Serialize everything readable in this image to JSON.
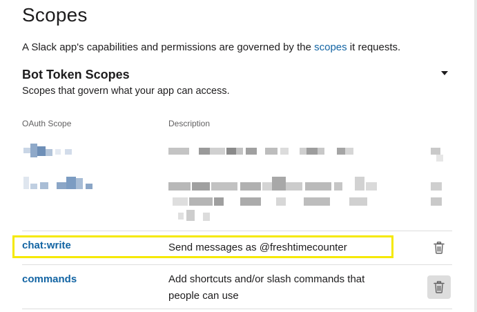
{
  "page": {
    "title": "Scopes",
    "intro_before": "A Slack app's capabilities and permissions are governed by the ",
    "intro_link": "scopes",
    "intro_after": " it requests."
  },
  "bot_section": {
    "title": "Bot Token Scopes",
    "subtitle": "Scopes that govern what your app can access.",
    "col_scope": "OAuth Scope",
    "col_description": "Description"
  },
  "scopes": [
    {
      "name": "chat:write",
      "description": "Send messages as @freshtimecounter",
      "highlighted": true
    },
    {
      "name": "commands",
      "description_line1": "Add shortcuts and/or slash commands that",
      "description_line2": "people can use"
    }
  ],
  "colors": {
    "link": "#1264a3",
    "highlight": "#f5e900",
    "text": "#1d1c1d",
    "muted": "#616061"
  },
  "icons": {
    "collapse": "caret-down-icon",
    "remove": "trash-icon"
  }
}
